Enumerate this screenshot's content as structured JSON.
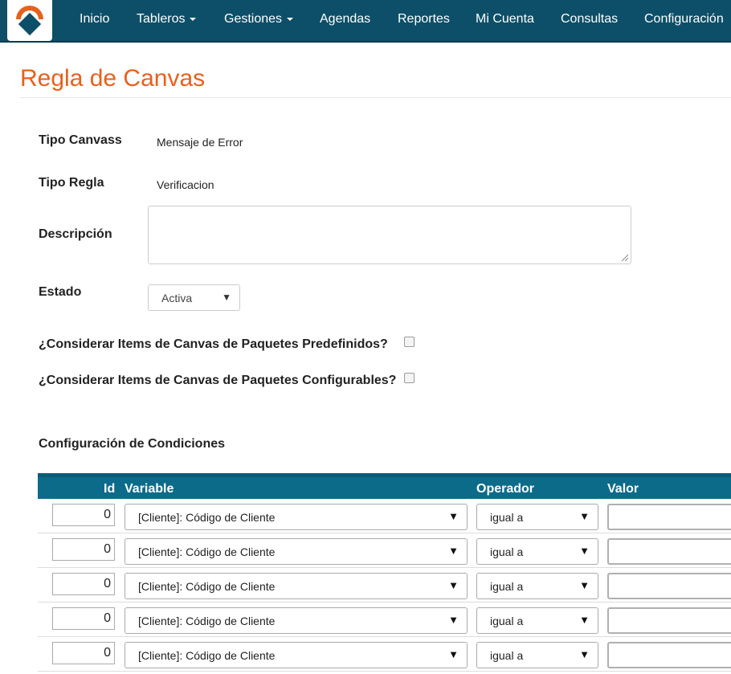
{
  "nav": {
    "items": [
      {
        "label": "Inicio",
        "dropdown": false
      },
      {
        "label": "Tableros",
        "dropdown": true
      },
      {
        "label": "Gestiones",
        "dropdown": true
      },
      {
        "label": "Agendas",
        "dropdown": false
      },
      {
        "label": "Reportes",
        "dropdown": false
      },
      {
        "label": "Mi Cuenta",
        "dropdown": false
      },
      {
        "label": "Consultas",
        "dropdown": false
      },
      {
        "label": "Configuración",
        "dropdown": false
      }
    ]
  },
  "page": {
    "title": "Regla de Canvas"
  },
  "form": {
    "tipo_canvass_label": "Tipo Canvass",
    "tipo_canvass_value": "Mensaje de Error",
    "tipo_regla_label": "Tipo Regla",
    "tipo_regla_value": "Verificacion",
    "descripcion_label": "Descripción",
    "descripcion_value": "",
    "estado_label": "Estado",
    "estado_value": "Activa",
    "predefinidos_label": "¿Considerar Items de Canvas de Paquetes Predefinidos?",
    "predefinidos_checked": false,
    "configurables_label": "¿Considerar Items de Canvas de Paquetes Configurables?",
    "configurables_checked": false
  },
  "conditions": {
    "section_title": "Configuración de Condiciones",
    "columns": [
      "Id",
      "Variable",
      "Operador",
      "Valor"
    ],
    "rows": [
      {
        "id": "0",
        "variable": "[Cliente]: Código de Cliente",
        "operator": "igual a",
        "value": ""
      },
      {
        "id": "0",
        "variable": "[Cliente]: Código de Cliente",
        "operator": "igual a",
        "value": ""
      },
      {
        "id": "0",
        "variable": "[Cliente]: Código de Cliente",
        "operator": "igual a",
        "value": ""
      },
      {
        "id": "0",
        "variable": "[Cliente]: Código de Cliente",
        "operator": "igual a",
        "value": ""
      },
      {
        "id": "0",
        "variable": "[Cliente]: Código de Cliente",
        "operator": "igual a",
        "value": ""
      }
    ]
  },
  "colors": {
    "navbar": "#0d4f68",
    "title": "#e8601c",
    "table_header": "#0d6b8a"
  },
  "icons": {
    "logo": "company-logo",
    "dropdown": "caret-down-icon",
    "select_arrow": "triangle-down-icon"
  }
}
